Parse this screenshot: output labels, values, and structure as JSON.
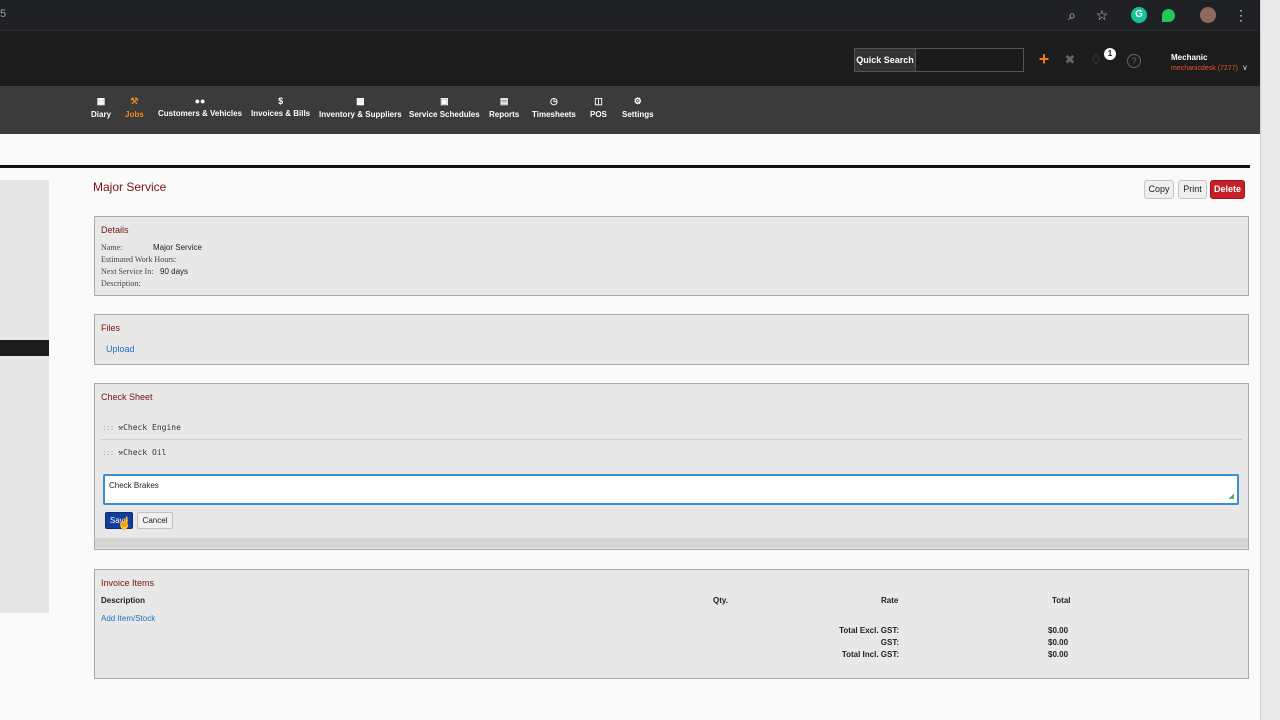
{
  "browser": {
    "left_glyph": "5",
    "icons": [
      "search-icon",
      "star-icon",
      "grammarly-extension-icon",
      "green-leaf-extension-icon",
      "profile-avatar-icon",
      "more-menu-icon"
    ]
  },
  "header": {
    "quick_search_label": "Quick Search",
    "quick_search_value": "",
    "notification_count": "1",
    "user_name": "Mechanic",
    "user_account": "mechanicdesk (7277)"
  },
  "nav": {
    "active": "Jobs",
    "items": [
      {
        "label": "Diary",
        "icon": "calendar-icon"
      },
      {
        "label": "Jobs",
        "icon": "wrench-icon"
      },
      {
        "label": "Customers & Vehicles",
        "icon": "users-icon"
      },
      {
        "label": "Invoices & Bills",
        "icon": "dollar-icon"
      },
      {
        "label": "Inventory & Suppliers",
        "icon": "inventory-icon"
      },
      {
        "label": "Service Schedules",
        "icon": "calendar-check-icon"
      },
      {
        "label": "Reports",
        "icon": "chart-icon"
      },
      {
        "label": "Timesheets",
        "icon": "clock-icon"
      },
      {
        "label": "POS",
        "icon": "store-icon"
      },
      {
        "label": "Settings",
        "icon": "gear-icon"
      }
    ]
  },
  "page": {
    "title": "Major Service",
    "actions": {
      "copy": "Copy",
      "print": "Print",
      "delete": "Delete"
    }
  },
  "details": {
    "title": "Details",
    "name_label": "Name:",
    "name_value": "Major Service",
    "hours_label": "Estimated Work Hours:",
    "hours_value": "",
    "next_label": "Next Service In:",
    "next_value": "90 days",
    "desc_label": "Description:",
    "desc_value": ""
  },
  "files": {
    "title": "Files",
    "upload_label": "Upload"
  },
  "check_sheet": {
    "title": "Check Sheet",
    "items": [
      "Check Engine",
      "Check Oil"
    ],
    "new_item_value": "Check Brakes",
    "save_label": "Save",
    "cancel_label": "Cancel"
  },
  "invoice_items": {
    "title": "Invoice Items",
    "columns": {
      "description": "Description",
      "qty": "Qty.",
      "rate": "Rate",
      "total": "Total"
    },
    "add_label": "Add Item/Stock",
    "totals": [
      {
        "label": "Total Excl. GST:",
        "value": "$0.00"
      },
      {
        "label": "GST:",
        "value": "$0.00"
      },
      {
        "label": "Total Incl. GST:",
        "value": "$0.00"
      }
    ]
  },
  "colors": {
    "header_bg": "#1c1c1c",
    "nav_bg": "#3b3b3b",
    "accent_orange": "#f08a20",
    "title_red": "#7a1010",
    "delete_red": "#c8202a",
    "link_blue": "#1f6fc1",
    "save_blue": "#123d9a"
  }
}
